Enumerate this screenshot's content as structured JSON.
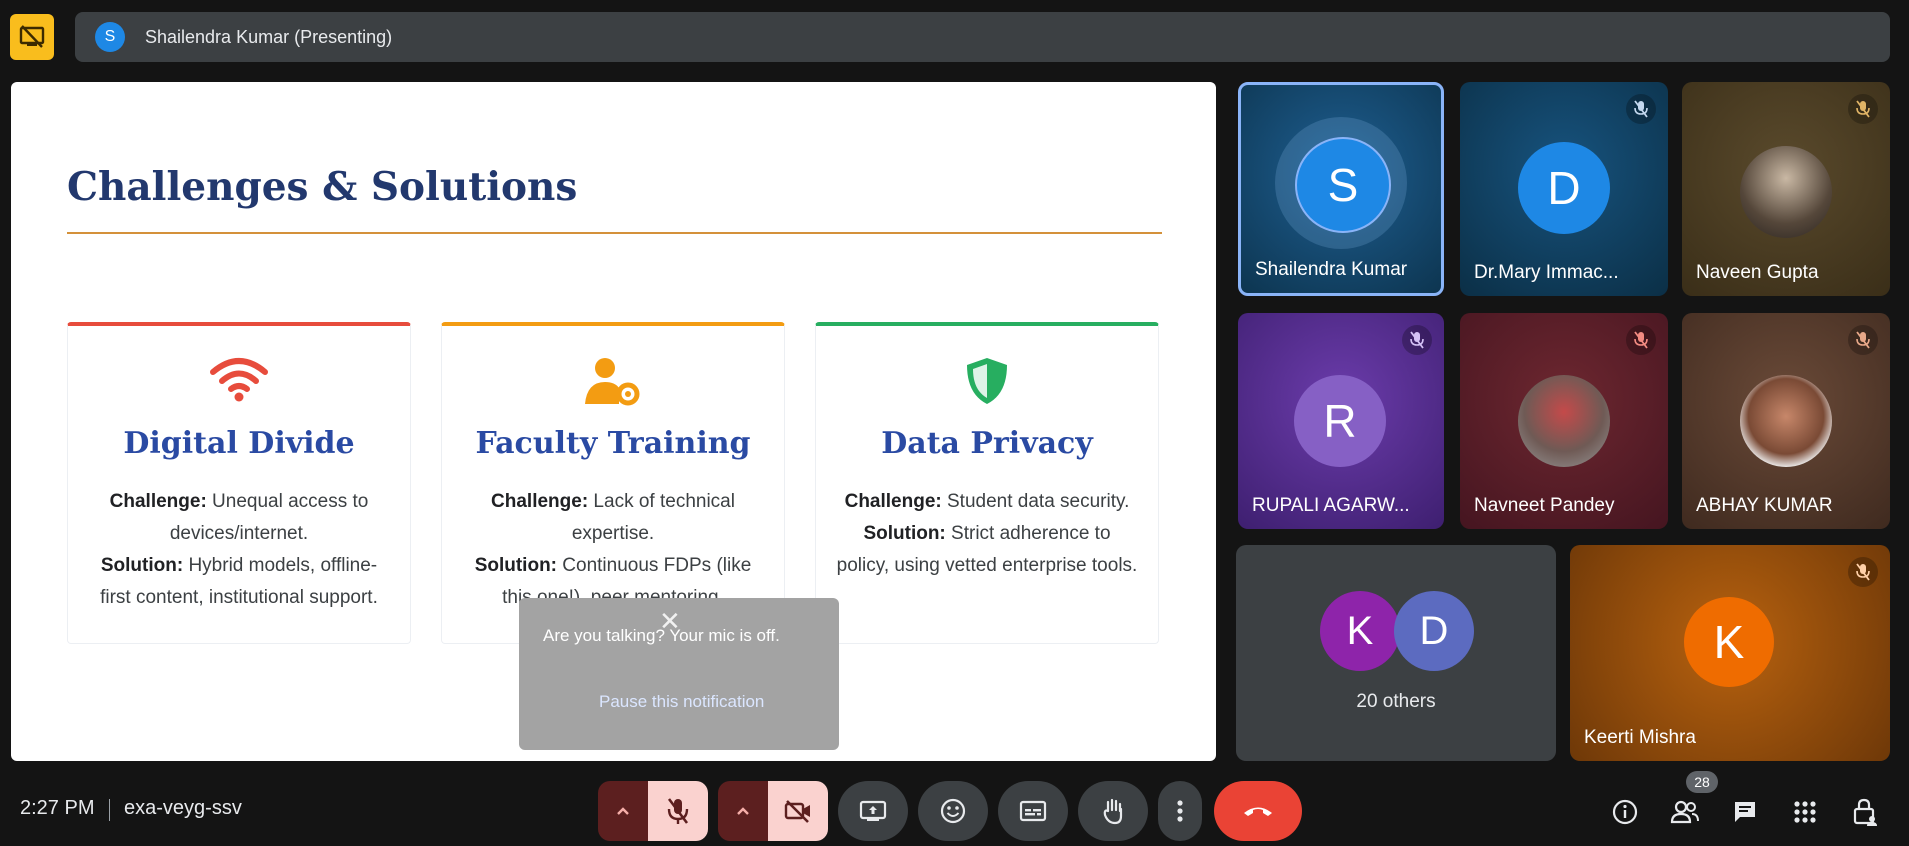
{
  "presenter_bar": {
    "avatar_letter": "S",
    "label": "Shailendra Kumar (Presenting)"
  },
  "slide": {
    "title": "Challenges & Solutions",
    "cards": [
      {
        "title": "Digital Divide",
        "challenge_label": "Challenge:",
        "challenge": " Unequal access to devices/internet.",
        "solution_label": "Solution:",
        "solution": " Hybrid models, offline-first content, institutional support.",
        "accent": "#e74c3c",
        "icon": "wifi-icon"
      },
      {
        "title": "Faculty Training",
        "challenge_label": "Challenge:",
        "challenge": " Lack of technical expertise.",
        "solution_label": "Solution:",
        "solution": " Continuous FDPs (like this one!), peer mentoring.",
        "accent": "#f39c12",
        "icon": "user-gear-icon"
      },
      {
        "title": "Data Privacy",
        "challenge_label": "Challenge:",
        "challenge": " Student data security.",
        "solution_label": "Solution:",
        "solution": " Strict adherence to policy, using vetted enterprise tools.",
        "accent": "#27ae60",
        "icon": "shield-icon"
      }
    ]
  },
  "toast": {
    "message": "Are you talking? Your mic is off.",
    "action": "Pause this notification"
  },
  "participants": [
    {
      "name": "Shailendra Kumar",
      "letter": "S"
    },
    {
      "name": "Dr.Mary Immac...",
      "letter": "D"
    },
    {
      "name": "Naveen Gupta"
    },
    {
      "name": "RUPALI AGARW...",
      "letter": "R"
    },
    {
      "name": "Navneet Pandey"
    },
    {
      "name": "ABHAY KUMAR"
    },
    {
      "name": "Keerti Mishra",
      "letter": "K"
    }
  ],
  "others": {
    "letters": [
      "K",
      "D"
    ],
    "label": "20 others"
  },
  "bottom": {
    "time": "2:27 PM",
    "meeting_code": "exa-veyg-ssv",
    "people_count": "28"
  }
}
